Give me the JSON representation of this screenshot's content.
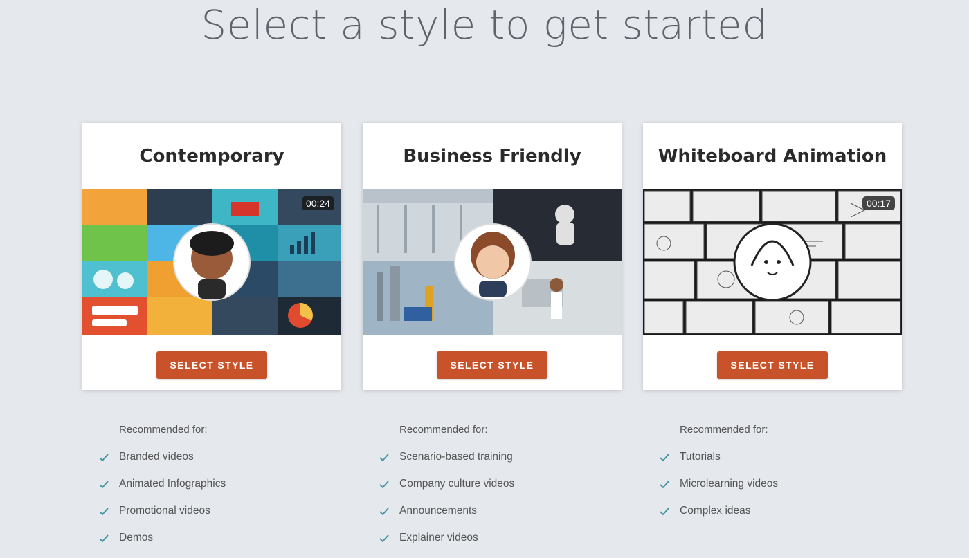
{
  "page": {
    "title": "Select a style to get started"
  },
  "accent": "#c8532a",
  "check_color": "#3a8fa0",
  "styles": [
    {
      "name": "Contemporary",
      "duration": "00:24",
      "button_label": "SELECT STYLE",
      "recommended_heading": "Recommended for:",
      "recommended": [
        "Branded videos",
        "Animated Infographics",
        "Promotional videos",
        "Demos"
      ]
    },
    {
      "name": "Business Friendly",
      "duration": "",
      "button_label": "SELECT STYLE",
      "recommended_heading": "Recommended for:",
      "recommended": [
        "Scenario-based training",
        "Company culture videos",
        "Announcements",
        "Explainer videos"
      ]
    },
    {
      "name": "Whiteboard Animation",
      "duration": "00:17",
      "button_label": "SELECT STYLE",
      "recommended_heading": "Recommended for:",
      "recommended": [
        "Tutorials",
        "Microlearning videos",
        "Complex ideas"
      ]
    }
  ]
}
